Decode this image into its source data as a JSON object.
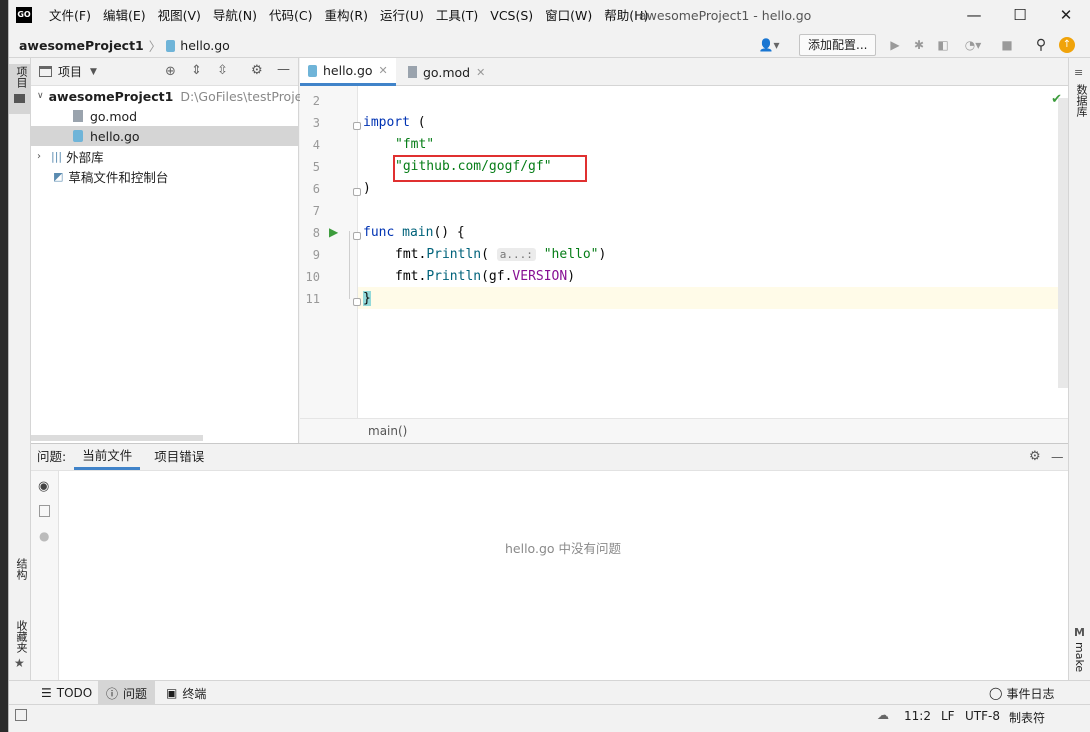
{
  "app": {
    "icon_label": "GO",
    "window_title": "awesomeProject1 - hello.go"
  },
  "menu": [
    "文件(F)",
    "编辑(E)",
    "视图(V)",
    "导航(N)",
    "代码(C)",
    "重构(R)",
    "运行(U)",
    "工具(T)",
    "VCS(S)",
    "窗口(W)",
    "帮助(H)"
  ],
  "window_controls": {
    "minimize": "—",
    "maximize": "☐",
    "close": "✕"
  },
  "navbar": {
    "project": "awesomeProject1",
    "file": "hello.go",
    "add_config": "添加配置..."
  },
  "left_strip": {
    "project_tab": "项目",
    "structure_tab": "结构",
    "favorites_tab": "收藏夹"
  },
  "right_strip": {
    "database_tab": "数据库",
    "make_tab": "make"
  },
  "project_panel": {
    "header": "项目",
    "root": {
      "name": "awesomeProject1",
      "path": "D:\\GoFiles\\testProje"
    },
    "files": [
      "go.mod",
      "hello.go"
    ],
    "external": "外部库",
    "scratches": "草稿文件和控制台"
  },
  "editor": {
    "tabs": [
      {
        "label": "hello.go",
        "active": true
      },
      {
        "label": "go.mod",
        "active": false
      }
    ],
    "lines": [
      {
        "n": "2",
        "text": ""
      },
      {
        "n": "3",
        "kw": "import",
        "rest": " ("
      },
      {
        "n": "4",
        "str": "\"fmt\""
      },
      {
        "n": "5",
        "str": "\"github.com/gogf/gf\""
      },
      {
        "n": "6",
        "rest": ")"
      },
      {
        "n": "7",
        "rest": ""
      },
      {
        "n": "8",
        "kw": "func",
        "fn": " main",
        "rest": "() {"
      },
      {
        "n": "9",
        "pk": "fmt.",
        "fn": "Println",
        "rest": "(",
        "hint": "a...:",
        "str": "\"hello\"",
        "end": ")"
      },
      {
        "n": "10",
        "pk": "fmt.",
        "fn": "Println",
        "rest": "(gf.",
        "fn2": "VERSION",
        "end": ")"
      },
      {
        "n": "11",
        "rest": "}"
      }
    ],
    "breadcrumb": "main()"
  },
  "problems": {
    "title": "问题:",
    "tabs": [
      "当前文件",
      "项目错误"
    ],
    "empty_message": "hello.go 中没有问题"
  },
  "bottom_tools": {
    "todo": "TODO",
    "problems": "问题",
    "terminal": "终端",
    "event_log": "事件日志"
  },
  "status": {
    "position": "11:2",
    "line_sep": "LF",
    "encoding": "UTF-8",
    "indent": "制表符"
  },
  "colors": {
    "accent": "#4083c9",
    "highlight_box": "#e03030",
    "run_green": "#3c9c3c",
    "update_orange": "#f0a30a"
  }
}
